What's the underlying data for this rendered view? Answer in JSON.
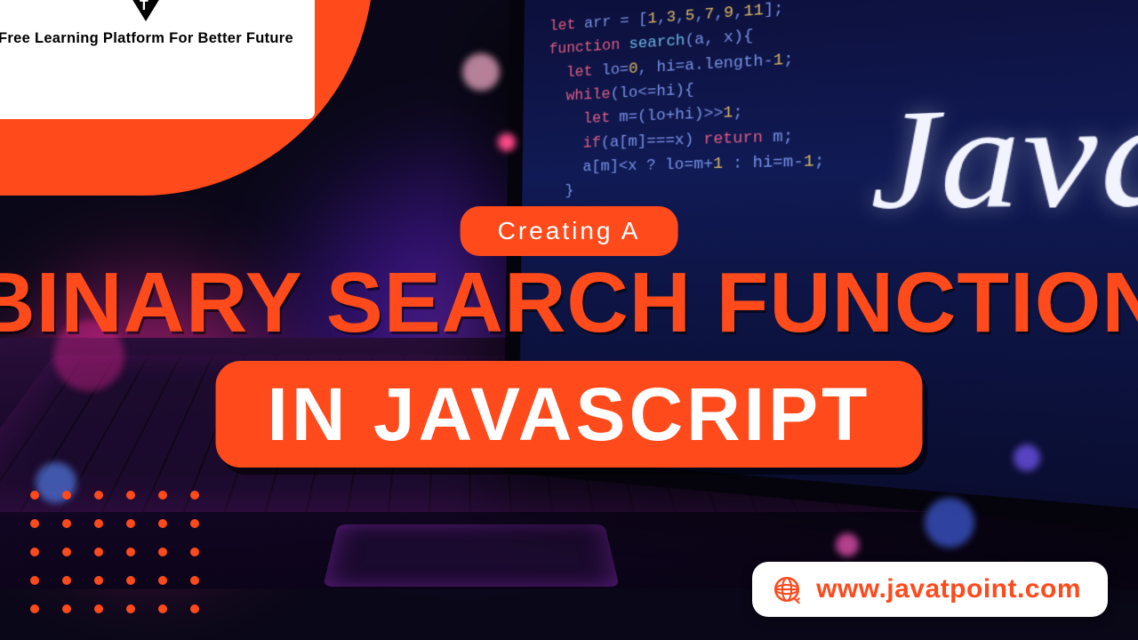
{
  "brand": {
    "logo_letter": "T",
    "tagline": "Free Learning Platform For Better Future"
  },
  "hero": {
    "kicker": "Creating  A",
    "headline": "BINARY SEARCH FUNCTION",
    "sub": "IN  JAVASCRIPT"
  },
  "screen": {
    "big_word": "Java"
  },
  "footer": {
    "url": "www.javatpoint.com"
  },
  "colors": {
    "accent": "#ff4a1c"
  }
}
